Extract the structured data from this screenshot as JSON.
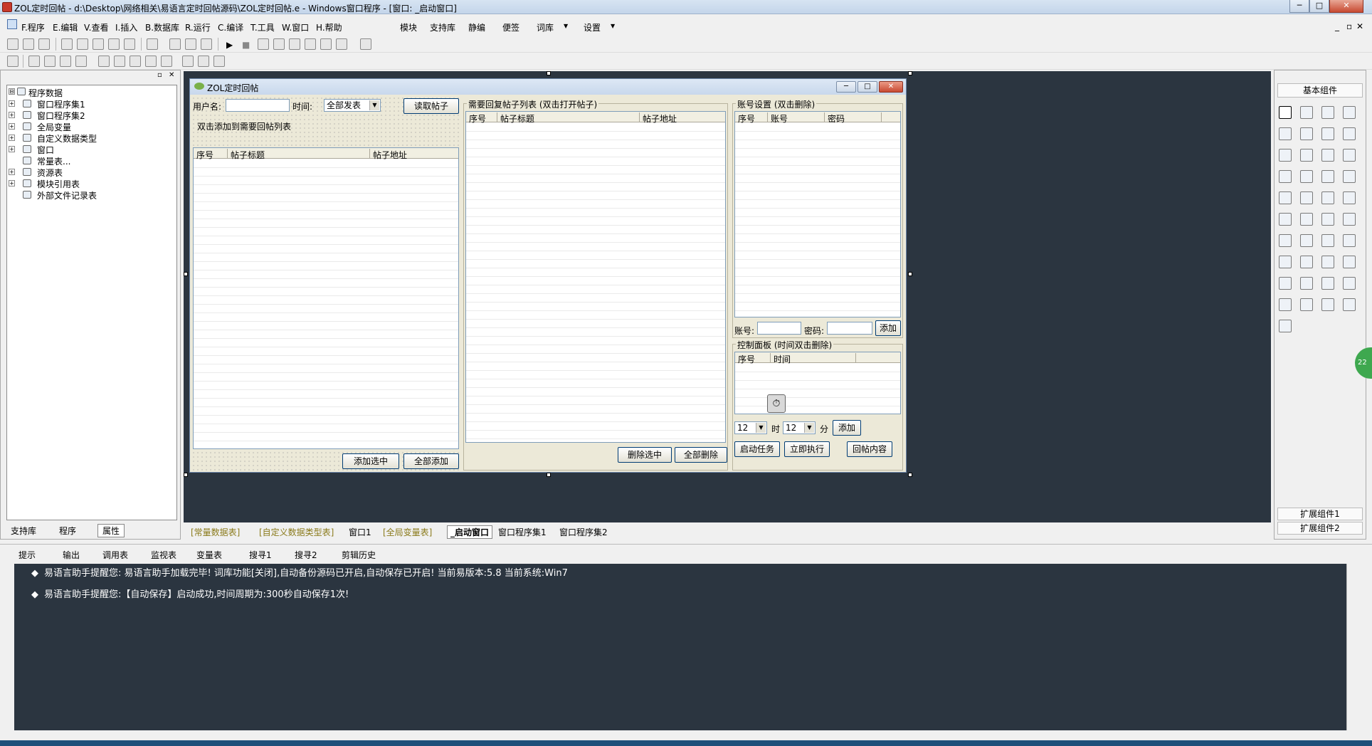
{
  "window": {
    "title": "ZOL定时回帖 - d:\\Desktop\\网络相关\\易语言定时回帖源码\\ZOL定时回帖.e - Windows窗口程序 - [窗口: _启动窗口]",
    "min": "─",
    "max": "□",
    "close": "✕"
  },
  "menu": [
    "F.程序",
    "E.编辑",
    "V.查看",
    "I.插入",
    "B.数据库",
    "R.运行",
    "C.编译",
    "T.工具",
    "W.窗口",
    "H.帮助",
    "模块",
    "支持库",
    "静编",
    "便签",
    "词库",
    "设置"
  ],
  "mdi_controls": [
    "_",
    "▫",
    "✕"
  ],
  "left_panel": {
    "pin": "▫",
    "close": "✕",
    "tree": [
      {
        "label": "程序数据",
        "expand": "⊟"
      },
      {
        "label": "窗口程序集1",
        "expand": "+"
      },
      {
        "label": "窗口程序集2",
        "expand": "+"
      },
      {
        "label": "全局变量",
        "expand": "+"
      },
      {
        "label": "自定义数据类型",
        "expand": "+"
      },
      {
        "label": "窗口",
        "expand": "+"
      },
      {
        "label": "常量表...",
        "expand": ""
      },
      {
        "label": "资源表",
        "expand": "+"
      },
      {
        "label": "模块引用表",
        "expand": "+"
      },
      {
        "label": "外部文件记录表",
        "expand": ""
      }
    ],
    "tabs": [
      "支持库",
      "程序",
      "属性"
    ]
  },
  "form": {
    "title": "ZOL定时回帖",
    "username_label": "用户名:",
    "time_label": "时间:",
    "time_value": "全部发表",
    "read_button": "读取帖子",
    "hint": "双击添加到需要回帖列表",
    "left_list_headers": [
      "序号",
      "帖子标题",
      "帖子地址"
    ],
    "add_selected": "添加选中",
    "add_all": "全部添加",
    "reply_group": "需要回复帖子列表 (双击打开帖子)",
    "reply_headers": [
      "序号",
      "帖子标题",
      "帖子地址"
    ],
    "delete_selected": "删除选中",
    "delete_all": "全部删除",
    "account_group": "账号设置 (双击删除)",
    "account_headers": [
      "序号",
      "账号",
      "密码"
    ],
    "account_label": "账号:",
    "password_label": "密码:",
    "account_add": "添加",
    "control_group": "控制面板 (时间双击删除)",
    "control_headers": [
      "序号",
      "时间"
    ],
    "hour_value": "12",
    "hour_label": "时",
    "minute_value": "12",
    "minute_label": "分",
    "time_add": "添加",
    "start_task": "启动任务",
    "run_now": "立即执行",
    "reply_content": "回帖内容"
  },
  "editor_tabs": [
    "[常量数据表]",
    "[自定义数据类型表]",
    "窗口1",
    "[全局变量表]",
    "_启动窗口",
    "窗口程序集1",
    "窗口程序集2"
  ],
  "right_panel": {
    "title": "基本组件",
    "ext1": "扩展组件1",
    "ext2": "扩展组件2",
    "badge": "22"
  },
  "output_tabs": [
    "提示",
    "输出",
    "调用表",
    "监视表",
    "变量表",
    "搜寻1",
    "搜寻2",
    "剪辑历史"
  ],
  "output_lines": [
    "易语言助手提醒您:  易语言助手加载完毕!  词库功能[关闭],自动备份源码已开启,自动保存已开启!  当前易版本:5.8  当前系统:Win7",
    "易语言助手提醒您:【自动保存】启动成功,时间周期为:300秒自动保存1次!"
  ],
  "colors": {
    "dark_bg": "#2b3540",
    "form_bg": "#ece9d8",
    "title_gradient": "#c4d5ea"
  }
}
